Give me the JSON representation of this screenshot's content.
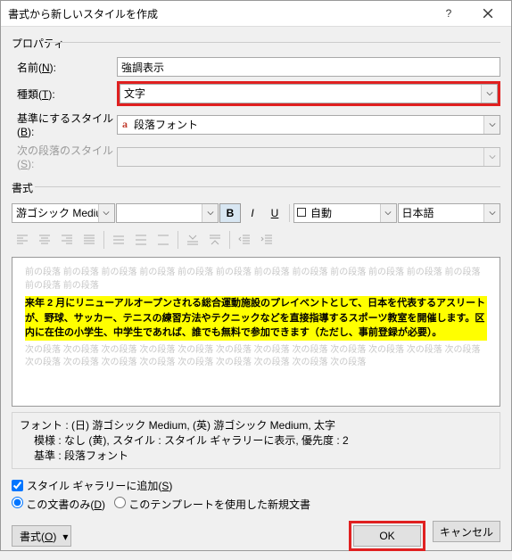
{
  "window": {
    "title": "書式から新しいスタイルを作成",
    "help": "?",
    "close": "×"
  },
  "props": {
    "group": "プロパティ",
    "name": {
      "label": "名前(N):",
      "value": "強調表示"
    },
    "type": {
      "label": "種類(T):",
      "value": "文字"
    },
    "base": {
      "label": "基準にするスタイル(B):",
      "value": "段落フォント",
      "icon": "a"
    },
    "next": {
      "label": "次の段落のスタイル(S):",
      "value": ""
    }
  },
  "fmt": {
    "group": "書式",
    "font": "游ゴシック Mediu",
    "bold": "B",
    "italic": "I",
    "under": "U",
    "color": "自動",
    "lang": "日本語"
  },
  "preview": {
    "ghost1": "前の段落 前の段落 前の段落 前の段落 前の段落 前の段落 前の段落 前の段落 前の段落 前の段落 前の段落 前の段落 前の段落 前の段落",
    "para": "来年 2 月にリニューアルオープンされる総合運動施設のプレイベントとして、日本を代表するアスリートが、野球、サッカー、テニスの練習方法やテクニックなどを直接指導するスポーツ教室を開催します。区内に在住の小学生、中学生であれば、誰でも無料で参加できます（ただし、事前登録が必要）。",
    "ghost2": "次の段落 次の段落 次の段落 次の段落 次の段落 次の段落 次の段落 次の段落 次の段落 次の段落 次の段落 次の段落 次の段落 次の段落 次の段落 次の段落 次の段落 次の段落 次の段落 次の段落 次の段落"
  },
  "desc": {
    "line1": "フォント : (日) 游ゴシック Medium, (英) 游ゴシック Medium, 太字",
    "line2": "模様 : なし (黄), スタイル : スタイル ギャラリーに表示, 優先度 : 2",
    "line3": "基準 : 段落フォント"
  },
  "opts": {
    "gallery": "スタイル ギャラリーに追加(S)",
    "radioA": "この文書のみ(D)",
    "radioB": "このテンプレートを使用した新規文書"
  },
  "footer": {
    "format": "書式(O)",
    "ok": "OK",
    "cancel": "キャンセル"
  }
}
